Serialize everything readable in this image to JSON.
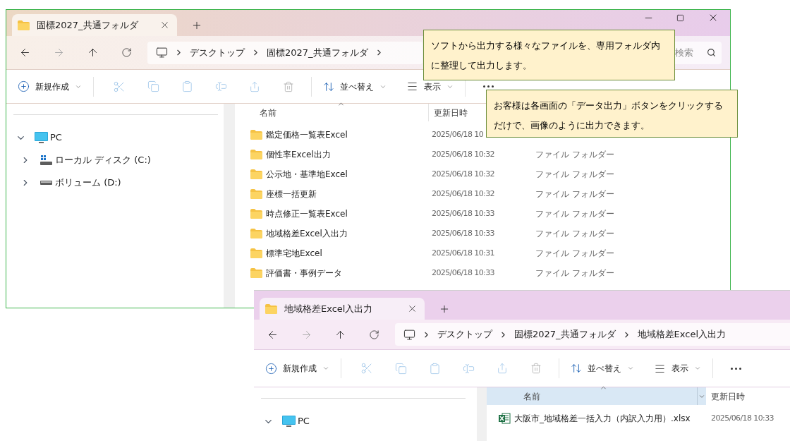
{
  "windows": [
    {
      "tab": {
        "title": "固標2027_共通フォルダ"
      },
      "window_controls": true,
      "breadcrumb": [
        "デスクトップ",
        "固標2027_共通フォルダ"
      ],
      "ends_with_chevron": true,
      "search": {
        "placeholder": "検索"
      },
      "toolbar": {
        "new": "新規作成",
        "sort": "並べ替え",
        "view": "表示"
      },
      "tree": [
        {
          "label": "PC",
          "kind": "pc",
          "expanded": true,
          "children": [
            {
              "label": "ローカル ディスク (C:)",
              "kind": "disk",
              "expanded": false
            },
            {
              "label": "ボリューム (D:)",
              "kind": "drive",
              "expanded": false
            }
          ]
        }
      ],
      "columns": [
        "名前",
        "更新日時"
      ],
      "header_highlighted": false,
      "rows": [
        {
          "kind": "folder",
          "name": "鑑定価格一覧表Excel",
          "date": "2025/06/18 10"
        },
        {
          "kind": "folder",
          "name": "個性率Excel出力",
          "date": "2025/06/18 10:32",
          "type": "ファイル フォルダー"
        },
        {
          "kind": "folder",
          "name": "公示地・基準地Excel",
          "date": "2025/06/18 10:32",
          "type": "ファイル フォルダー"
        },
        {
          "kind": "folder",
          "name": "座標一括更新",
          "date": "2025/06/18 10:32",
          "type": "ファイル フォルダー"
        },
        {
          "kind": "folder",
          "name": "時点修正一覧表Excel",
          "date": "2025/06/18 10:33",
          "type": "ファイル フォルダー"
        },
        {
          "kind": "folder",
          "name": "地域格差Excel入出力",
          "date": "2025/06/18 10:33",
          "type": "ファイル フォルダー"
        },
        {
          "kind": "folder",
          "name": "標準宅地Excel",
          "date": "2025/06/18 10:31",
          "type": "ファイル フォルダー"
        },
        {
          "kind": "folder",
          "name": "評価書・事例データ",
          "date": "2025/06/18 10:33",
          "type": "ファイル フォルダー"
        }
      ]
    },
    {
      "tab": {
        "title": "地域格差Excel入出力"
      },
      "window_controls": false,
      "breadcrumb": [
        "デスクトップ",
        "固標2027_共通フォルダ",
        "地域格差Excel入出力"
      ],
      "ends_with_chevron": false,
      "toolbar": {
        "new": "新規作成",
        "sort": "並べ替え",
        "view": "表示"
      },
      "tree": [
        {
          "label": "PC",
          "kind": "pc",
          "expanded": true
        }
      ],
      "columns": [
        "名前",
        "更新日時"
      ],
      "header_highlighted": true,
      "rows": [
        {
          "kind": "excel",
          "name": "大阪市_地域格差一括入力（内訳入力用）.xlsx",
          "date": "2025/06/18 10:33"
        }
      ]
    }
  ],
  "callouts": [
    {
      "text": "ソフトから出力する様々なファイルを、専用フォルダ内に整理して出力します。"
    },
    {
      "text": "お客様は各画面の「データ出力」ボタンをクリックするだけで、画像のように出力できます。"
    }
  ]
}
